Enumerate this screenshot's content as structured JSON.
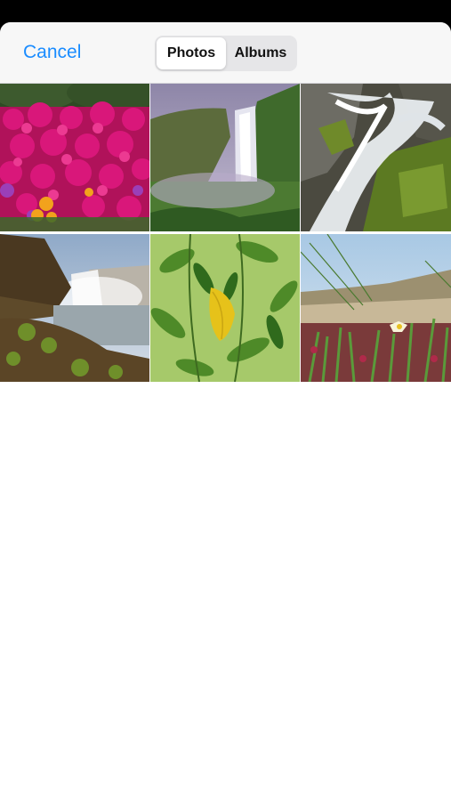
{
  "navbar": {
    "cancel_label": "Cancel",
    "segments": [
      {
        "label": "Photos",
        "selected": true
      },
      {
        "label": "Albums",
        "selected": false
      }
    ]
  },
  "colors": {
    "accent": "#1a8cff",
    "segment_background": "#e6e6e8",
    "navbar_background": "#f7f7f7"
  },
  "photos": [
    {
      "subject": "pink flowers"
    },
    {
      "subject": "waterfall valley"
    },
    {
      "subject": "cascading waterfall over mossy rocks"
    },
    {
      "subject": "waterfall behind mossy cliff"
    },
    {
      "subject": "yellow leaf among green leaves"
    },
    {
      "subject": "coastal grass with flowers"
    }
  ]
}
